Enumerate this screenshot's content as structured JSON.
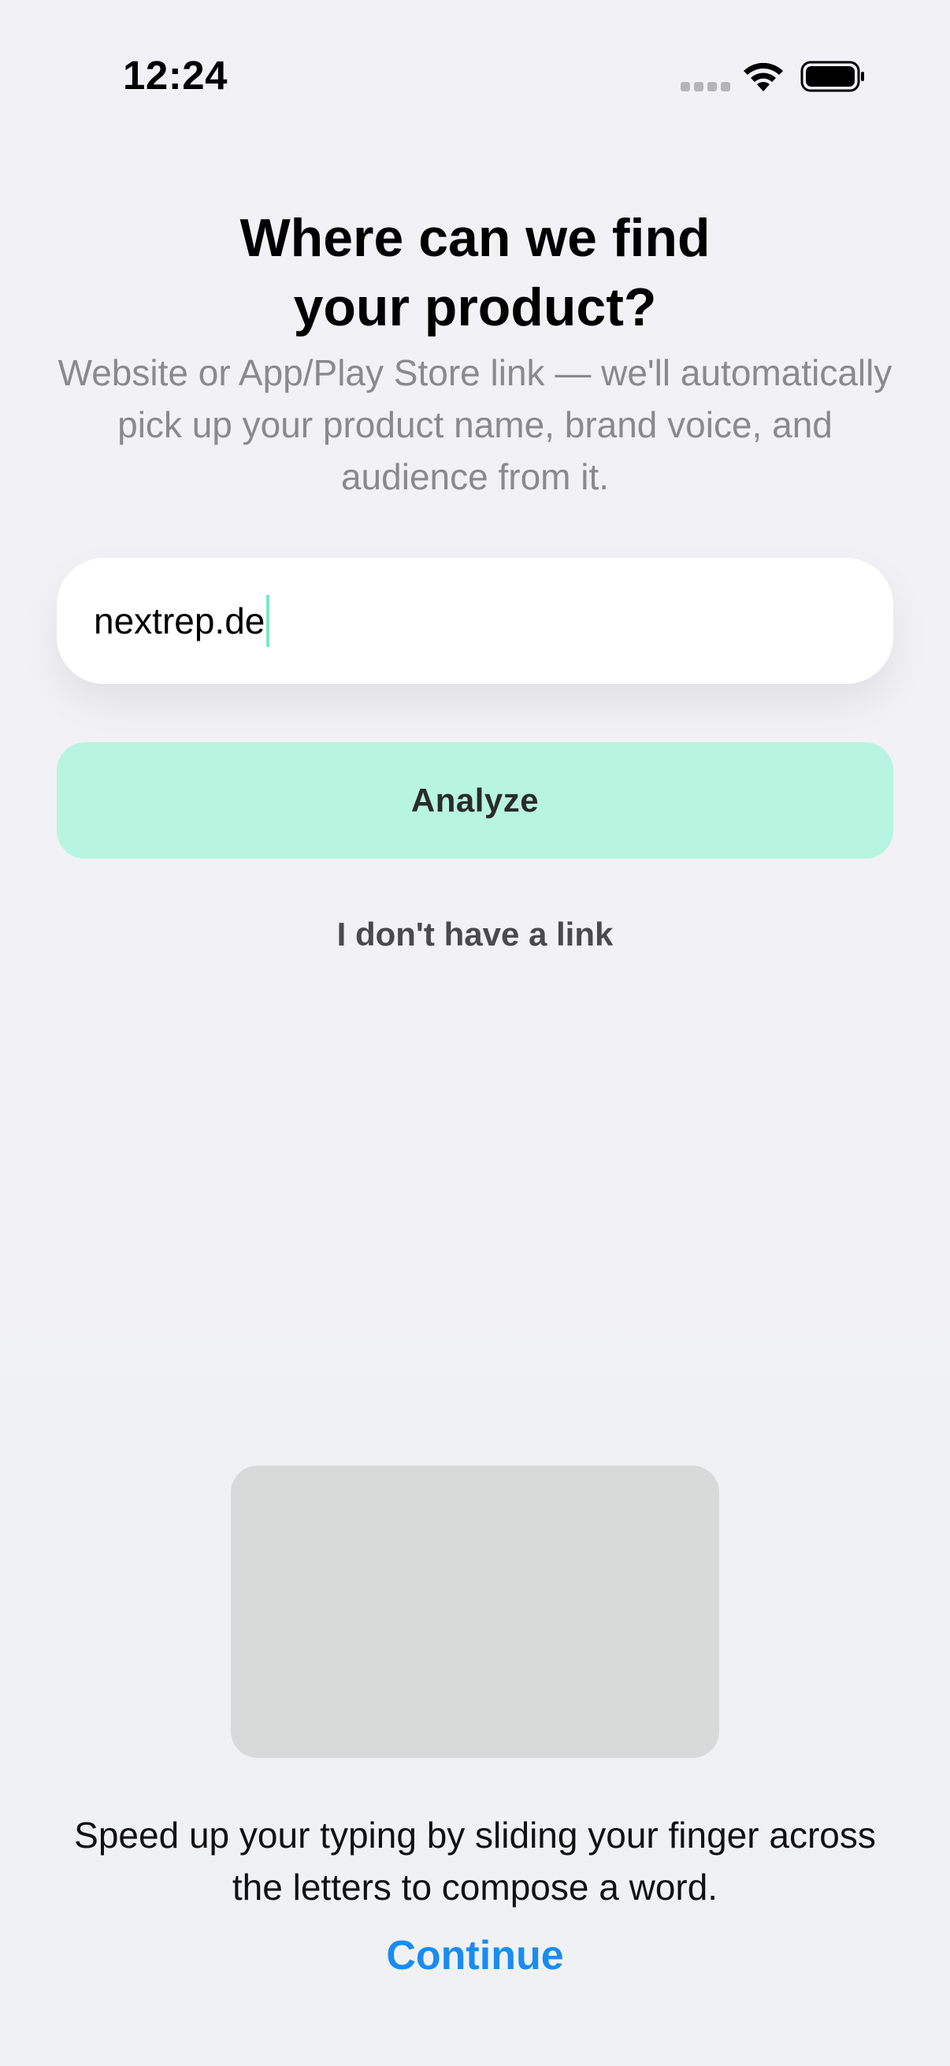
{
  "status_bar": {
    "time": "12:24",
    "icons": [
      "cellular-signal-icon",
      "wifi-icon",
      "battery-icon"
    ]
  },
  "header": {
    "title_line1": "Where can we find",
    "title_line2": "your product?",
    "subtitle": "Website or App/Play Store link — we'll automatically pick up your product name, brand voice, and audience from it."
  },
  "form": {
    "url_value": "nextrep.de",
    "analyze_label": "Analyze",
    "no_link_label": "I don't have a link"
  },
  "keyboard_tip": {
    "text": "Speed up your typing by sliding your finger across the letters to compose a word.",
    "continue_label": "Continue"
  },
  "colors": {
    "accent": "#b8f5e1",
    "caret": "#7be8c4",
    "link": "#1a8cf0",
    "background": "#f2f2f6"
  }
}
